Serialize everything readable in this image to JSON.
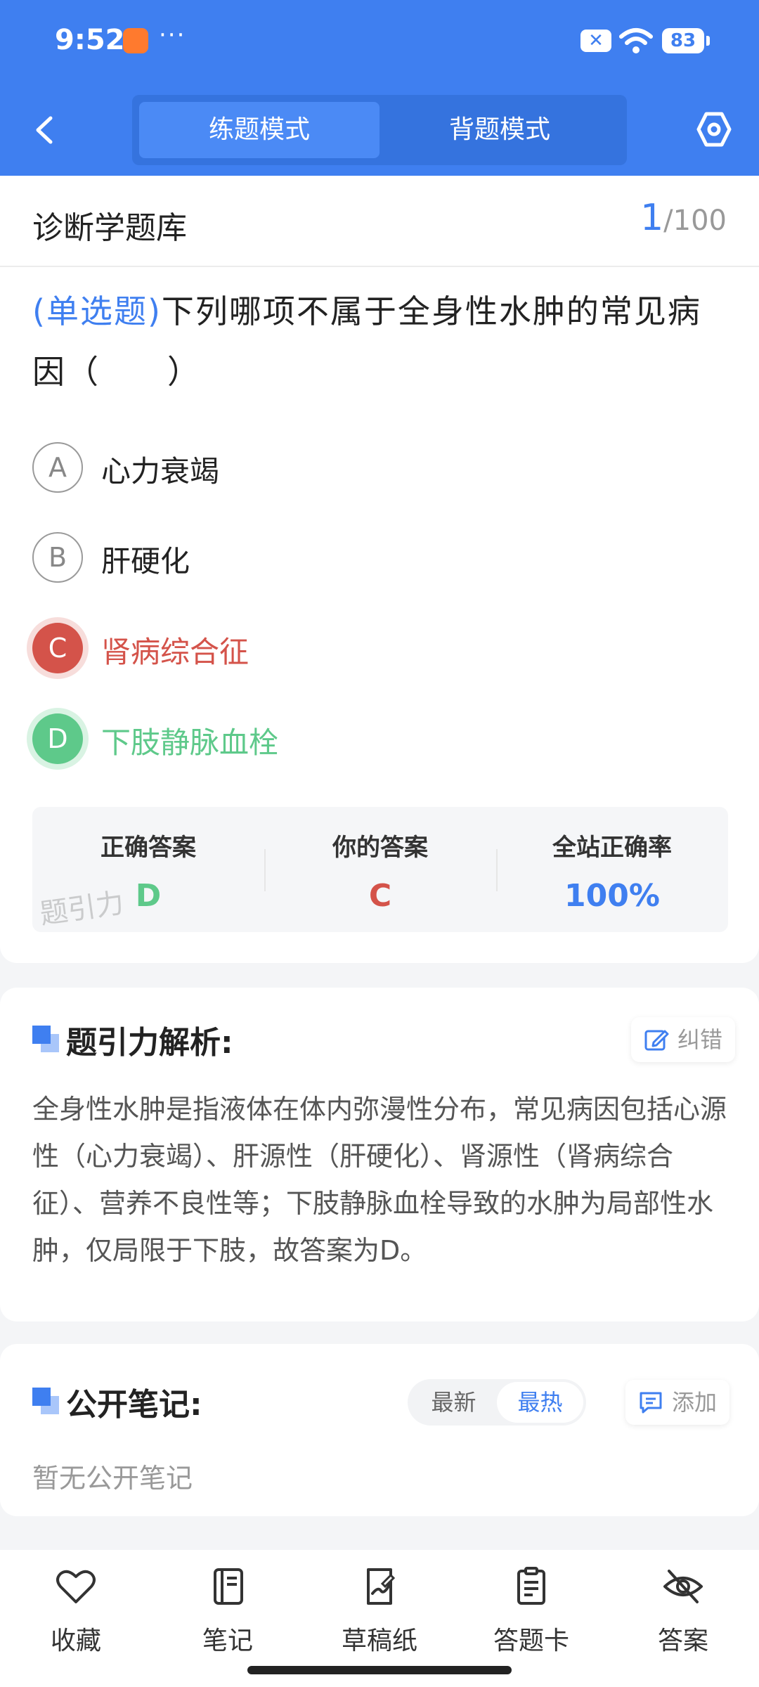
{
  "status_bar": {
    "time": "9:52",
    "dots": "···",
    "x_badge": "✕",
    "battery": "83"
  },
  "header": {
    "tabs": [
      {
        "label": "练题模式",
        "active": true
      },
      {
        "label": "背题模式",
        "active": false
      }
    ]
  },
  "bank": {
    "title": "诊断学题库",
    "current": "1",
    "total": "/100"
  },
  "question": {
    "type": "(单选题)",
    "text": "下列哪项不属于全身性水肿的常见病因（　　）"
  },
  "options": [
    {
      "letter": "A",
      "text": "心力衰竭",
      "state": "normal"
    },
    {
      "letter": "B",
      "text": "肝硬化",
      "state": "normal"
    },
    {
      "letter": "C",
      "text": "肾病综合征",
      "state": "wrong"
    },
    {
      "letter": "D",
      "text": "下肢静脉血栓",
      "state": "correct"
    }
  ],
  "stats": {
    "correct_label": "正确答案",
    "correct_value": "D",
    "yours_label": "你的答案",
    "yours_value": "C",
    "rate_label": "全站正确率",
    "rate_value": "100%",
    "watermark": "题引力"
  },
  "analysis": {
    "title": "题引力解析:",
    "report_label": "纠错",
    "text": "全身性水肿是指液体在体内弥漫性分布，常见病因包括心源性（心力衰竭）、肝源性（肝硬化）、肾源性（肾病综合征）、营养不良性等；下肢静脉血栓导致的水肿为局部性水肿，仅局限于下肢，故答案为D。"
  },
  "notes": {
    "title": "公开笔记:",
    "sort_options": [
      {
        "label": "最新",
        "active": false
      },
      {
        "label": "最热",
        "active": true
      }
    ],
    "add_label": "添加",
    "empty": "暂无公开笔记"
  },
  "bottom_nav": [
    {
      "label": "收藏",
      "icon": "heart-icon"
    },
    {
      "label": "笔记",
      "icon": "notebook-icon"
    },
    {
      "label": "草稿纸",
      "icon": "draft-icon"
    },
    {
      "label": "答题卡",
      "icon": "answer-card-icon"
    },
    {
      "label": "答案",
      "icon": "eye-off-icon"
    }
  ],
  "colors": {
    "primary": "#3f7ff0",
    "wrong": "#d4534a",
    "correct": "#5ec98a"
  }
}
